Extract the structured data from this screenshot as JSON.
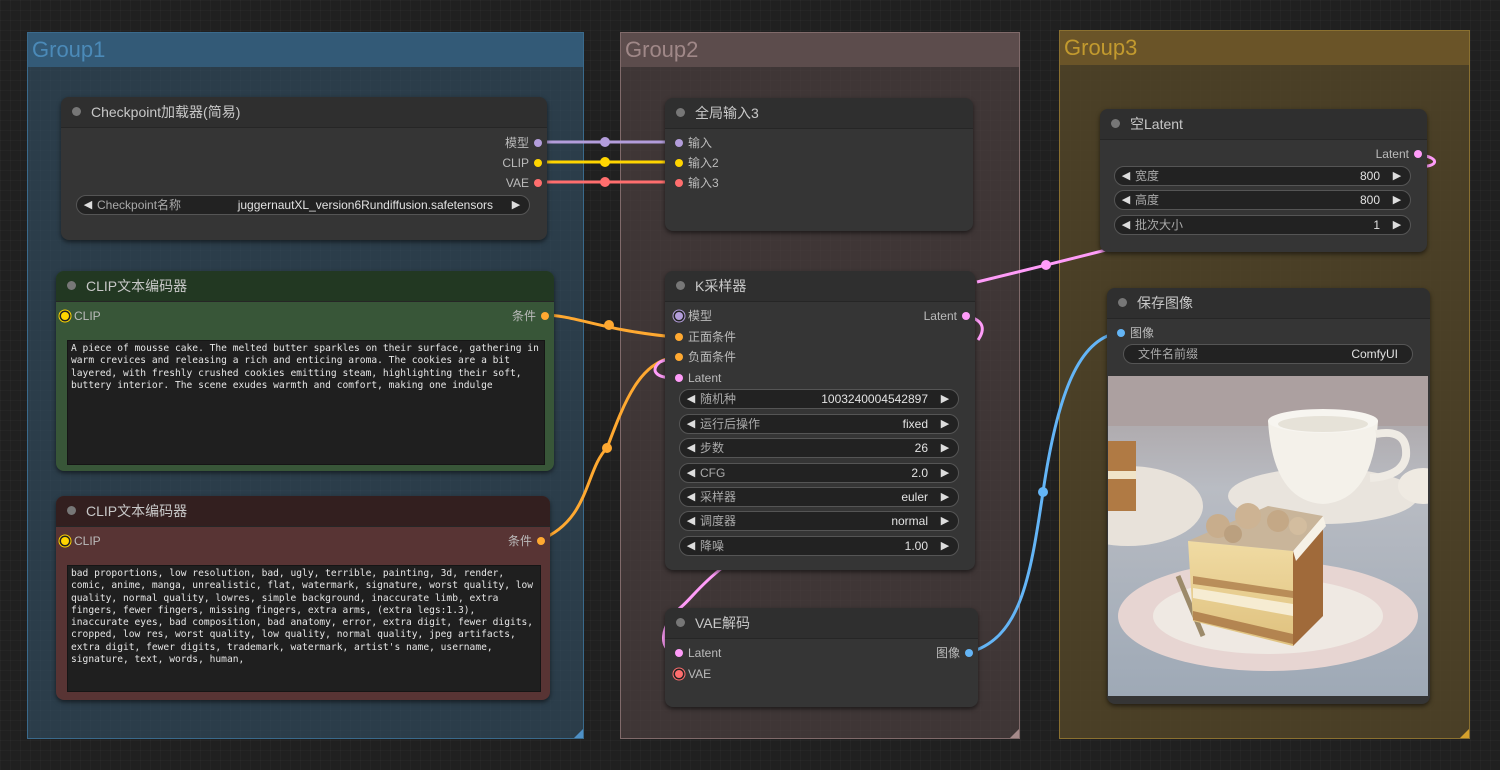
{
  "groups": [
    {
      "title": "Group1",
      "color": "#4b8ab8"
    },
    {
      "title": "Group2",
      "color": "#a08888"
    },
    {
      "title": "Group3",
      "color": "#c29a2e"
    }
  ],
  "slot_colors": {
    "model": "#b39ddb",
    "clip": "#ffd500",
    "vae": "#ff6e6e",
    "conditioning": "#ffa931",
    "latent": "#ff9cf9",
    "image": "#64b5f6"
  },
  "checkpoint_loader": {
    "title": "Checkpoint加载器(简易)",
    "outputs": [
      "模型",
      "CLIP",
      "VAE"
    ],
    "widget": {
      "label": "Checkpoint名称",
      "value": "juggernautXL_version6Rundiffusion.safetensors"
    }
  },
  "clip_positive": {
    "title": "CLIP文本编码器",
    "input": "CLIP",
    "output": "条件",
    "text": "A piece of mousse cake. The melted butter sparkles on their surface, gathering in warm crevices and releasing a rich and enticing aroma. The cookies are a bit layered, with freshly crushed cookies emitting steam, highlighting their soft, buttery interior. The scene exudes warmth and comfort, making one indulge"
  },
  "clip_negative": {
    "title": "CLIP文本编码器",
    "input": "CLIP",
    "output": "条件",
    "text": "bad proportions, low resolution, bad, ugly, terrible, painting, 3d, render, comic, anime, manga, unrealistic, flat, watermark, signature, worst quality, low quality, normal quality, lowres, simple background, inaccurate limb, extra fingers, fewer fingers, missing fingers, extra arms, (extra legs:1.3), inaccurate eyes, bad composition, bad anatomy, error, extra digit, fewer digits, cropped, low res, worst quality, low quality, normal quality, jpeg artifacts, extra digit, fewer digits, trademark, watermark, artist's name, username, signature, text, words, human,"
  },
  "global_input": {
    "title": "全局输入3",
    "inputs": [
      "输入",
      "输入2",
      "输入3"
    ]
  },
  "ksampler": {
    "title": "K采样器",
    "inputs": [
      "模型",
      "正面条件",
      "负面条件",
      "Latent"
    ],
    "output": "Latent",
    "widgets": [
      {
        "label": "随机种",
        "value": "1003240004542897"
      },
      {
        "label": "运行后操作",
        "value": "fixed"
      },
      {
        "label": "步数",
        "value": "26"
      },
      {
        "label": "CFG",
        "value": "2.0"
      },
      {
        "label": "采样器",
        "value": "euler"
      },
      {
        "label": "调度器",
        "value": "normal"
      },
      {
        "label": "降噪",
        "value": "1.00"
      }
    ]
  },
  "vae_decode": {
    "title": "VAE解码",
    "inputs": [
      "Latent",
      "VAE"
    ],
    "output": "图像"
  },
  "empty_latent": {
    "title": "空Latent",
    "output": "Latent",
    "widgets": [
      {
        "label": "宽度",
        "value": "800"
      },
      {
        "label": "高度",
        "value": "800"
      },
      {
        "label": "批次大小",
        "value": "1"
      }
    ]
  },
  "save_image": {
    "title": "保存图像",
    "input": "图像",
    "widget": {
      "label": "文件名前缀",
      "value": "ComfyUI"
    },
    "preview_alt": "mousse cake slice on plate with teacup"
  },
  "icons": {
    "arrow_left": "◀",
    "arrow_right": "▶"
  }
}
